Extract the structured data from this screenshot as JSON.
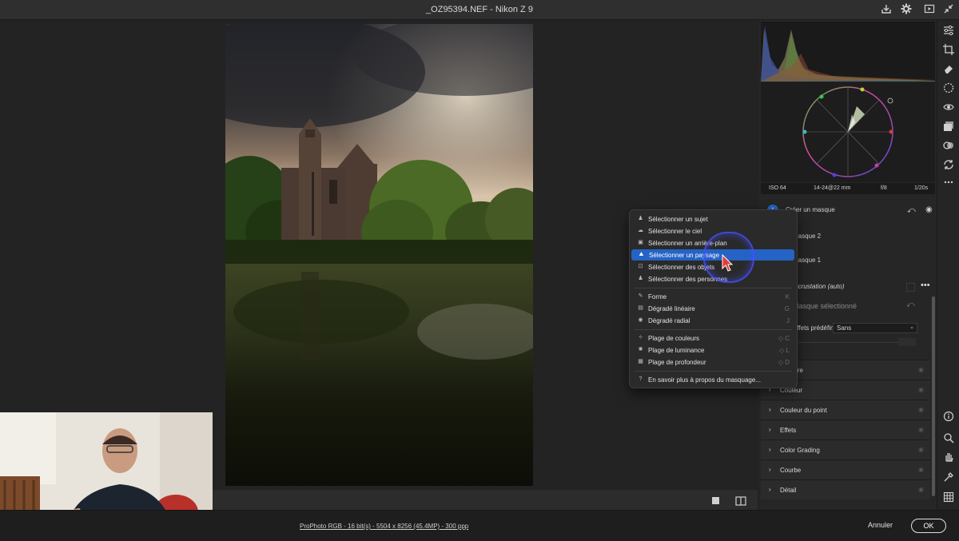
{
  "window": {
    "title": "_OZ95394.NEF  -  Nikon Z 9"
  },
  "exif": {
    "iso": "ISO 64",
    "lens": "14-24@22 mm",
    "aperture": "f/8",
    "shutter": "1/20s"
  },
  "mask_panel": {
    "create_label": "Créer un masque",
    "mask2": "Masque 2",
    "mask1": "Masque 1",
    "overlay": "Incrustation (auto)",
    "selected_mask": "Masque sélectionné",
    "presets_label": "Effets prédéfinis",
    "presets_value": "Sans"
  },
  "sections": [
    {
      "label": "Lumière"
    },
    {
      "label": "Couleur"
    },
    {
      "label": "Couleur du point"
    },
    {
      "label": "Effets"
    },
    {
      "label": "Color Grading"
    },
    {
      "label": "Courbe"
    },
    {
      "label": "Détail"
    }
  ],
  "menu": {
    "items": [
      {
        "label": "Sélectionner un sujet",
        "shortcut": ""
      },
      {
        "label": "Sélectionner le ciel",
        "shortcut": ""
      },
      {
        "label": "Sélectionner un arrière-plan",
        "shortcut": ""
      },
      {
        "label": "Sélectionner un paysage",
        "shortcut": ""
      },
      {
        "label": "Sélectionner des objets",
        "shortcut": ""
      },
      {
        "label": "Sélectionner des personnes",
        "shortcut": ""
      },
      {
        "label": "Forme",
        "shortcut": "K"
      },
      {
        "label": "Dégradé linéaire",
        "shortcut": "G"
      },
      {
        "label": "Dégradé radial",
        "shortcut": "J"
      },
      {
        "label": "Plage de couleurs",
        "shortcut": "◇ C"
      },
      {
        "label": "Plage de luminance",
        "shortcut": "◇ L"
      },
      {
        "label": "Plage de profondeur",
        "shortcut": "◇ D"
      },
      {
        "label": "En savoir plus à propos du masquage...",
        "shortcut": ""
      }
    ]
  },
  "footer": {
    "info": "ProPhoto RGB - 16 bit(s) - 5504 x 8256 (45.4MP) - 300 ppp",
    "cancel": "Annuler",
    "ok": "OK"
  },
  "colors": {
    "accent": "#2563c5",
    "panel": "#262626"
  }
}
